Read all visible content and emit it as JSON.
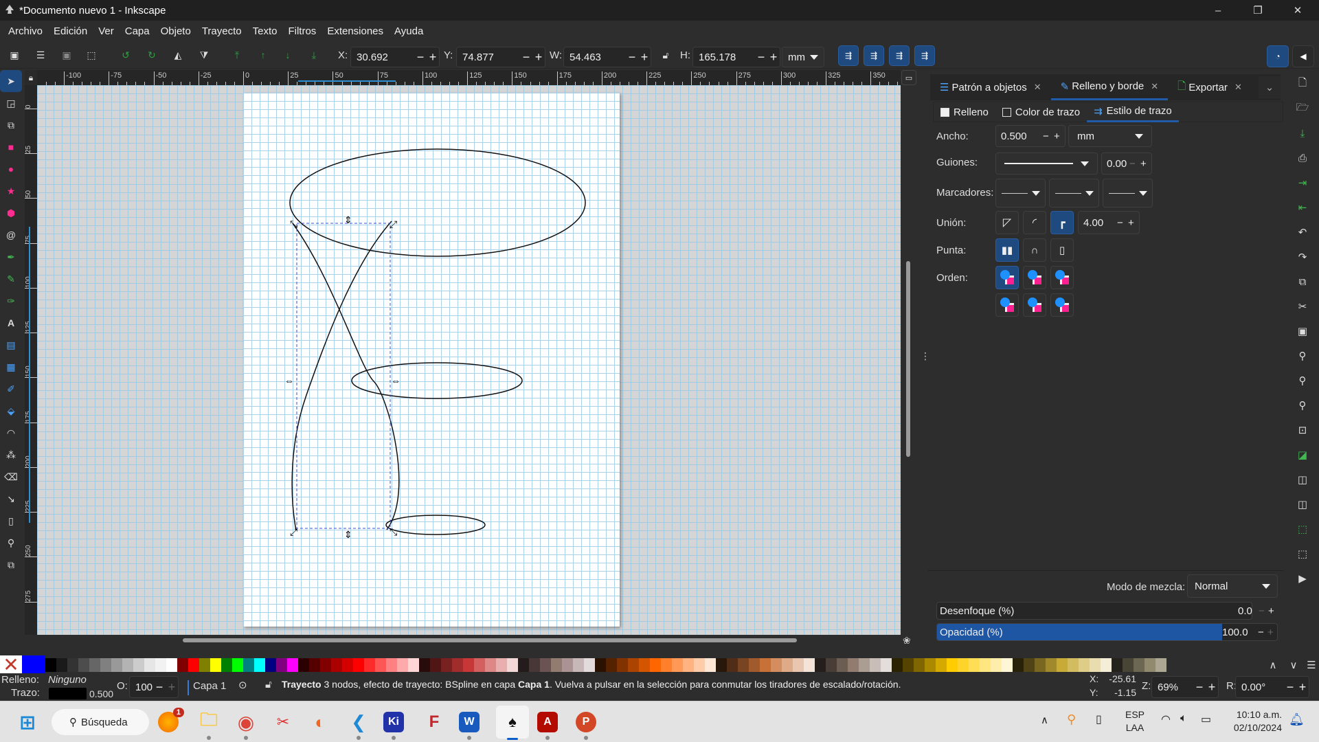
{
  "window": {
    "title": "*Documento nuevo 1 - Inkscape",
    "minimize": "–",
    "maximize": "❐",
    "close": "✕"
  },
  "menu": [
    "Archivo",
    "Edición",
    "Ver",
    "Capa",
    "Objeto",
    "Trayecto",
    "Texto",
    "Filtros",
    "Extensiones",
    "Ayuda"
  ],
  "toolbar": {
    "x_label": "X:",
    "x_value": "30.692",
    "y_label": "Y:",
    "y_value": "74.877",
    "w_label": "W:",
    "w_value": "54.463",
    "h_label": "H:",
    "h_value": "165.178",
    "unit": "mm",
    "minus": "−",
    "plus": "+"
  },
  "ruler": {
    "h_ticks": [
      "-100",
      "-75",
      "-50",
      "-25",
      "0",
      "25",
      "50",
      "75",
      "100",
      "125",
      "150",
      "175",
      "200",
      "225",
      "250",
      "275",
      "300",
      "325",
      "350"
    ],
    "v_ticks": [
      "0",
      "25",
      "50",
      "75",
      "100",
      "125",
      "150",
      "175",
      "200",
      "225",
      "250",
      "275"
    ]
  },
  "dock": {
    "tabs": [
      {
        "label": "Patrón a objetos",
        "icon": "pattern-icon"
      },
      {
        "label": "Relleno y borde",
        "icon": "fill-stroke-icon",
        "active": true
      },
      {
        "label": "Exportar",
        "icon": "export-icon"
      }
    ],
    "subtabs": [
      {
        "label": "Relleno"
      },
      {
        "label": "Color de trazo"
      },
      {
        "label": "Estilo de trazo",
        "active": true
      }
    ],
    "width_label": "Ancho:",
    "width_value": "0.500",
    "width_unit": "mm",
    "dashes_label": "Guiones:",
    "dashes_offset": "0.00",
    "markers_label": "Marcadores:",
    "join_label": "Unión:",
    "miter_value": "4.00",
    "cap_label": "Punta:",
    "order_label": "Orden:",
    "blend_label": "Modo de mezcla:",
    "blend_value": "Normal",
    "blur_label": "Desenfoque (%)",
    "blur_value": "0.0",
    "opacity_label": "Opacidad (%)",
    "opacity_value": "100.0",
    "opacity_fraction": 1.0
  },
  "status": {
    "fill_label": "Relleno:",
    "fill_value": "Ninguno",
    "stroke_label": "Trazo:",
    "stroke_width": "0.500",
    "opacity_label": "O:",
    "opacity_value": "100",
    "layer": "Capa 1",
    "message_bold": "Trayecto",
    "message": " 3 nodos, efecto de trayecto: BSpline en capa ",
    "message_layer": "Capa 1",
    "message_tail": ". Vuelva a pulsar en la selección para conmutar los tiradores de escalado/rotación.",
    "cursor_x_label": "X:",
    "cursor_x": "-25.61",
    "cursor_y_label": "Y:",
    "cursor_y": "-1.15",
    "zoom_label": "Z:",
    "zoom_value": "69%",
    "rotate_label": "R:",
    "rotate_value": "0.00°"
  },
  "palette": [
    "#000000",
    "#1a1a1a",
    "#333333",
    "#4d4d4d",
    "#666666",
    "#808080",
    "#999999",
    "#b3b3b3",
    "#cccccc",
    "#e6e6e6",
    "#f2f2f2",
    "#ffffff",
    "#800000",
    "#ff0000",
    "#808000",
    "#ffff00",
    "#008000",
    "#00ff00",
    "#008080",
    "#00ffff",
    "#000080",
    "#800080",
    "#ff00ff",
    "#2b0000",
    "#550000",
    "#800000",
    "#aa0000",
    "#d40000",
    "#ff0000",
    "#ff2a2a",
    "#ff5555",
    "#ff8080",
    "#ffaaaa",
    "#ffd5d5",
    "#280b0b",
    "#501616",
    "#782121",
    "#a02c2c",
    "#c83737",
    "#d35f5f",
    "#de8787",
    "#e9afaf",
    "#f4d7d7",
    "#241c1c",
    "#483737",
    "#6c5353",
    "#917c6f",
    "#ac9393",
    "#c8b7b7",
    "#e3dbdb",
    "#2b1100",
    "#552200",
    "#803300",
    "#aa4400",
    "#d45500",
    "#ff6600",
    "#ff7f2a",
    "#ff9955",
    "#ffb380",
    "#ffccaa",
    "#ffe6d5",
    "#28170b",
    "#502d16",
    "#784421",
    "#a05a2c",
    "#c87137",
    "#d38d5f",
    "#deaa87",
    "#e9c6af",
    "#f4e3d7",
    "#241f1c",
    "#483e37",
    "#6c5d53",
    "#917c6f",
    "#ac9d93",
    "#c8beb7",
    "#e3dedb",
    "#2b2200",
    "#554400",
    "#806600",
    "#aa8800",
    "#d4aa00",
    "#ffcc00",
    "#ffd42a",
    "#ffdd55",
    "#ffe680",
    "#ffeeaa",
    "#fff6d5",
    "#28220b",
    "#504416",
    "#786721",
    "#a0892c",
    "#c8ab37",
    "#d3bc5f",
    "#decd87",
    "#e9ddaf",
    "#f4eed7",
    "#24221c",
    "#484537",
    "#6c6753",
    "#918a6f",
    "#aca793"
  ],
  "taskbar": {
    "search": "Búsqueda",
    "apps": [
      "firefox",
      "explorer",
      "chrome",
      "snipping",
      "app-orange",
      "vscode",
      "ki",
      "formats",
      "word",
      "inkscape",
      "acrobat",
      "powerpoint"
    ],
    "badge": "1",
    "lang1": "ESP",
    "lang2": "LAA",
    "time": "10:10 a.m.",
    "date": "02/10/2024"
  }
}
